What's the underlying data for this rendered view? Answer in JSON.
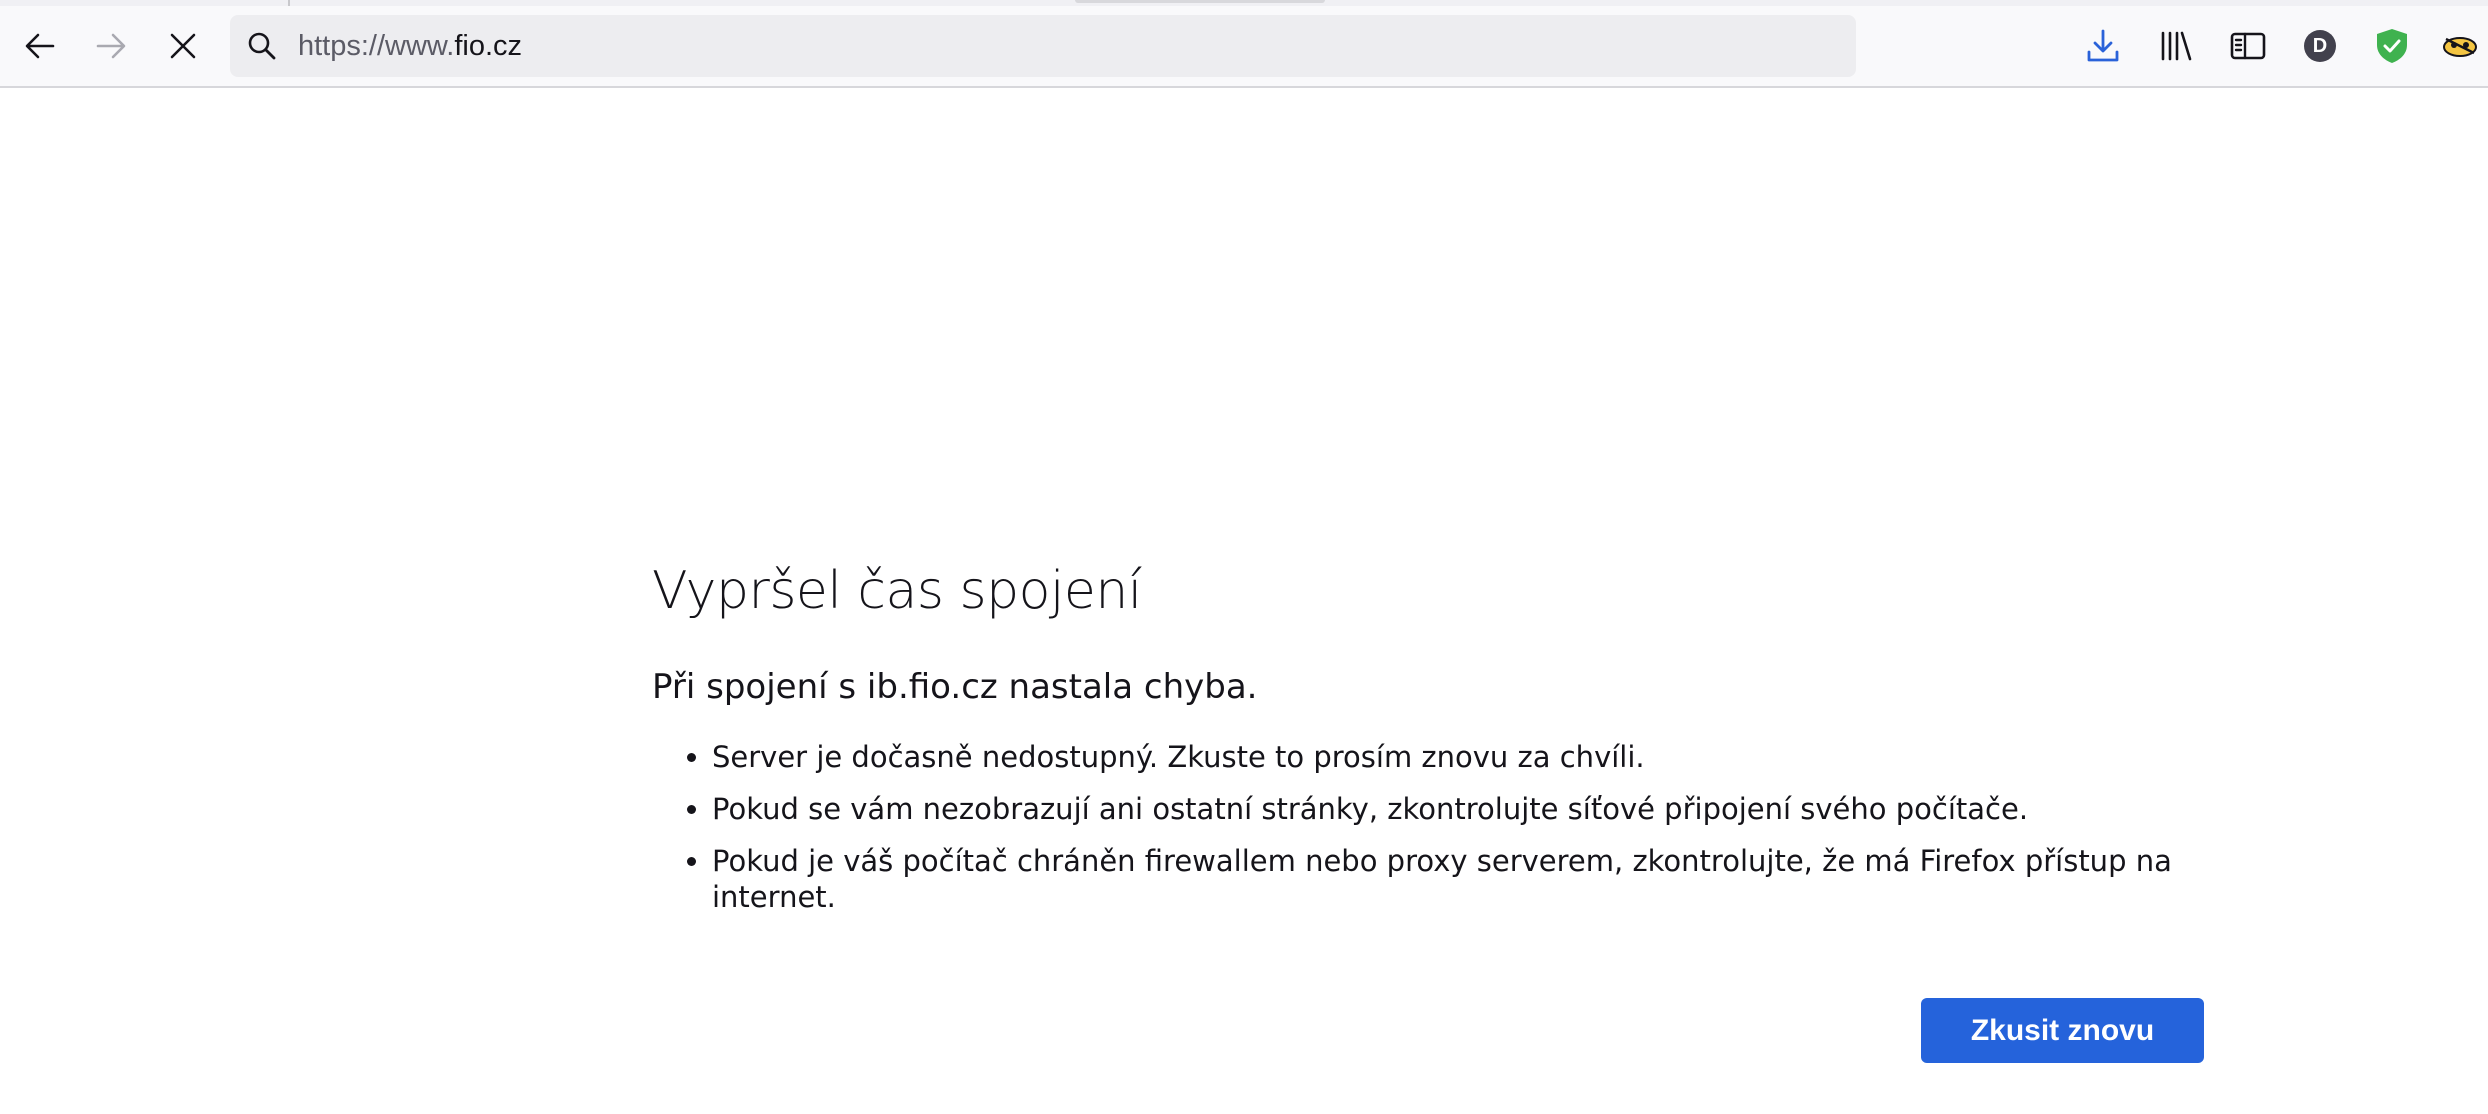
{
  "browser": {
    "url_scheme": "https://www.",
    "url_host": "fio.cz",
    "icons": {
      "back": "arrow-left-icon",
      "forward": "arrow-right-icon",
      "stop": "close-icon",
      "search": "search-icon",
      "downloads": "download-icon",
      "library": "library-icon",
      "sidebar": "sidebar-icon",
      "account": "account-avatar-icon",
      "shield": "shield-check-icon",
      "extension": "extension-icon"
    },
    "account_letter": "D",
    "colors": {
      "toolbar_bg": "#f9f9fb",
      "urlbar_bg": "#ededf0",
      "accent": "#2563db",
      "shield": "#3fb24f"
    }
  },
  "error": {
    "title": "Vypršel čas spojení",
    "description": "Při spojení s ib.fio.cz nastala chyba.",
    "items": [
      "Server je dočasně nedostupný. Zkuste to prosím znovu za chvíli.",
      "Pokud se vám nezobrazují ani ostatní stránky, zkontrolujte síťové připojení svého počítače.",
      "Pokud je váš počítač chráněn firewallem nebo proxy serverem, zkontrolujte, že má Firefox přístup na internet."
    ],
    "retry_label": "Zkusit znovu"
  }
}
